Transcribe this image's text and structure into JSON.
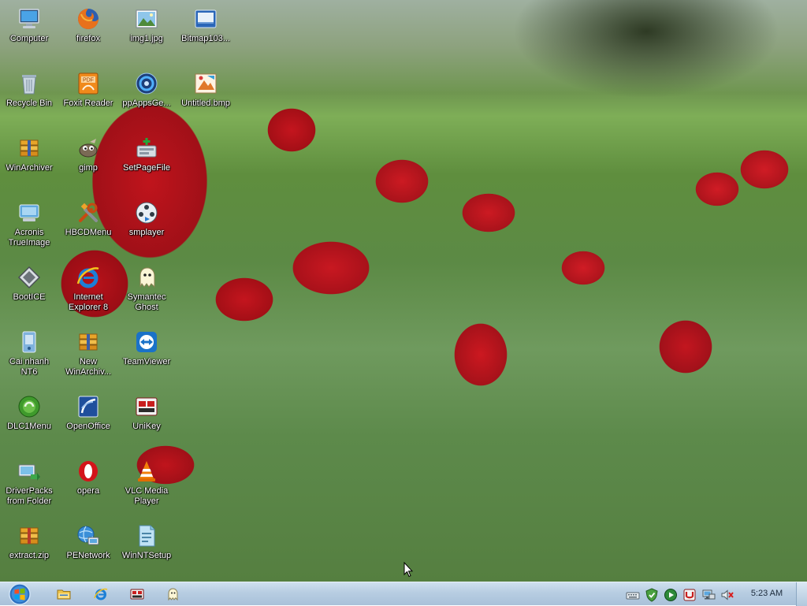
{
  "desktop": {
    "icons": [
      {
        "label": "Computer",
        "icon": "computer-icon"
      },
      {
        "label": "firefox",
        "icon": "firefox-icon"
      },
      {
        "label": "img1.jpg",
        "icon": "image-file-icon"
      },
      {
        "label": "Bitmap103...",
        "icon": "bitmap-file-icon"
      },
      {
        "label": "Recycle Bin",
        "icon": "recycle-bin-icon"
      },
      {
        "label": "Foxit Reader",
        "icon": "pdf-reader-icon"
      },
      {
        "label": "ppAppsGe...",
        "icon": "app-globe-icon"
      },
      {
        "label": "Untitled.bmp",
        "icon": "paint-file-icon"
      },
      {
        "label": "WinArchiver",
        "icon": "archive-icon"
      },
      {
        "label": "gimp",
        "icon": "gimp-icon"
      },
      {
        "label": "SetPageFile",
        "icon": "setup-tool-icon"
      },
      {
        "label": "Acronis\nTrueImage",
        "icon": "acronis-icon"
      },
      {
        "label": "HBCDMenu",
        "icon": "tools-icon"
      },
      {
        "label": "smplayer",
        "icon": "media-player-icon"
      },
      {
        "label": "BootICE",
        "icon": "boot-tool-icon"
      },
      {
        "label": "Internet\nExplorer 8",
        "icon": "internet-explorer-icon"
      },
      {
        "label": "Symantec\nGhost",
        "icon": "ghost-icon"
      },
      {
        "label": "Cai nhanh\nNT6",
        "icon": "installer-icon"
      },
      {
        "label": "New\nWinArchiv...",
        "icon": "archive-file-icon"
      },
      {
        "label": "TeamViewer",
        "icon": "teamviewer-icon"
      },
      {
        "label": "DLC1Menu",
        "icon": "dlc-menu-icon"
      },
      {
        "label": "OpenOffice",
        "icon": "openoffice-icon"
      },
      {
        "label": "UniKey",
        "icon": "unikey-icon"
      },
      {
        "label": "DriverPacks\nfrom Folder",
        "icon": "driver-pack-icon"
      },
      {
        "label": "opera",
        "icon": "opera-icon"
      },
      {
        "label": "VLC Media\nPlayer",
        "icon": "vlc-icon"
      },
      {
        "label": "extract.zip",
        "icon": "zip-file-icon"
      },
      {
        "label": "PENetwork",
        "icon": "network-icon"
      },
      {
        "label": "WinNTSetup",
        "icon": "setup-icon"
      }
    ]
  },
  "taskbar": {
    "clock": "5:23 AM",
    "pinned": [
      "explorer-icon",
      "internet-explorer-icon",
      "unikey-icon",
      "ghost-icon"
    ],
    "tray": [
      "keyboard-icon",
      "security-shield-icon",
      "media-play-icon",
      "unikey-tray-icon",
      "network-status-icon",
      "volume-muted-icon"
    ]
  },
  "colors": {
    "taskbar": "#b7cde2",
    "label_text": "#ffffff"
  }
}
